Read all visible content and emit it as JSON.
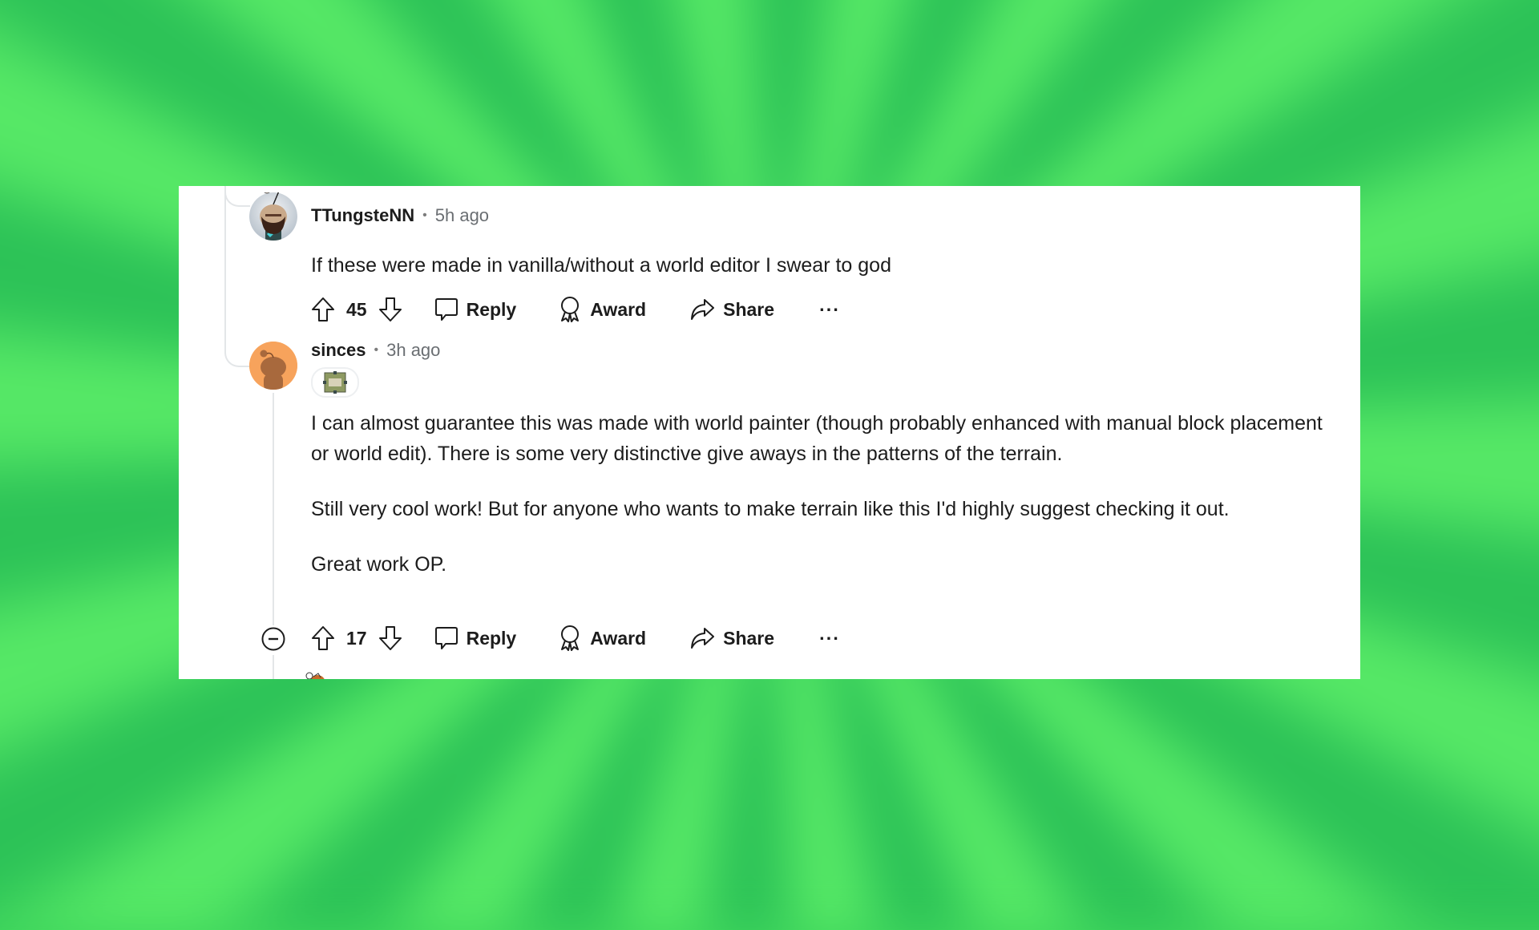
{
  "background": {
    "accent_dark": "#2cc257",
    "accent_light": "#56e866"
  },
  "comments": [
    {
      "username": "TTungsteNN",
      "separator": "•",
      "time": "5h ago",
      "avatar_icon": "snoo-bearded-avatar",
      "body": [
        "If these were made in vanilla/without a world editor I swear to god"
      ],
      "score": "45",
      "actions": {
        "reply": "Reply",
        "award": "Award",
        "share": "Share",
        "more": "···"
      }
    },
    {
      "username": "sinces",
      "separator": "•",
      "time": "3h ago",
      "avatar_icon": "snoo-orange-avatar",
      "avatar_color": "#f7a35c",
      "flair_icon": "minecraft-map-flair",
      "body": [
        "I can almost guarantee this was made with world painter (though probably enhanced with manual block placement or world edit). There is some very distinctive give aways in the patterns of the terrain.",
        "Still very cool work! But for anyone who wants to make terrain like this I'd highly suggest checking it out.",
        "Great work OP."
      ],
      "score": "17",
      "actions": {
        "reply": "Reply",
        "award": "Award",
        "share": "Share",
        "more": "···"
      }
    }
  ]
}
